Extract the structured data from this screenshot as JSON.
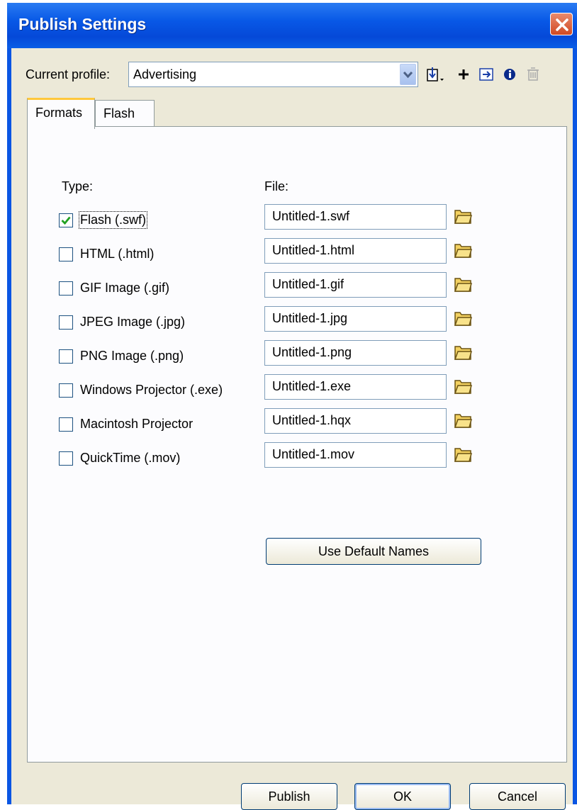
{
  "window": {
    "title": "Publish Settings"
  },
  "profile": {
    "label": "Current profile:",
    "value": "Advertising"
  },
  "toolbar": {
    "icons": [
      "import-export-icon",
      "add-icon",
      "duplicate-icon",
      "info-icon",
      "delete-icon"
    ]
  },
  "tabs": [
    {
      "label": "Formats",
      "active": true
    },
    {
      "label": "Flash",
      "active": false
    }
  ],
  "columns": {
    "type": "Type:",
    "file": "File:"
  },
  "formats": [
    {
      "label": "Flash (.swf)",
      "checked": true,
      "file": "Untitled-1.swf"
    },
    {
      "label": "HTML (.html)",
      "checked": false,
      "file": "Untitled-1.html"
    },
    {
      "label": "GIF Image (.gif)",
      "checked": false,
      "file": "Untitled-1.gif"
    },
    {
      "label": "JPEG Image (.jpg)",
      "checked": false,
      "file": "Untitled-1.jpg"
    },
    {
      "label": "PNG Image (.png)",
      "checked": false,
      "file": "Untitled-1.png"
    },
    {
      "label": "Windows Projector (.exe)",
      "checked": false,
      "file": "Untitled-1.exe"
    },
    {
      "label": "Macintosh Projector",
      "checked": false,
      "file": "Untitled-1.hqx"
    },
    {
      "label": "QuickTime (.mov)",
      "checked": false,
      "file": "Untitled-1.mov"
    }
  ],
  "buttons": {
    "default_names": "Use Default Names",
    "publish": "Publish",
    "ok": "OK",
    "cancel": "Cancel"
  },
  "colors": {
    "title_bar": "#0a56e3",
    "dialog_bg": "#ece9d8",
    "check_mark": "#21a121",
    "close_button": "#d14a23",
    "folder": "#f2d060"
  }
}
